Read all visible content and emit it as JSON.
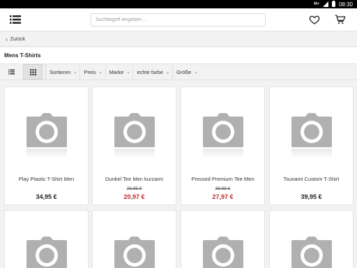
{
  "statusbar": {
    "network": "H+",
    "time": "08:30"
  },
  "header": {
    "search_placeholder": "Suchbegriff eingeben ...",
    "icons": {
      "menu": "hamburger-menu-icon",
      "wishlist": "heart-icon",
      "cart": "cart-icon"
    }
  },
  "backbar": {
    "label": "Zurück"
  },
  "page": {
    "title": "Mens T-Shirts"
  },
  "filters": [
    {
      "label": "Sortieren"
    },
    {
      "label": "Preis"
    },
    {
      "label": "Marke"
    },
    {
      "label": "echte farbe"
    },
    {
      "label": "Größe"
    }
  ],
  "colors": {
    "sale_price": "#c1272d",
    "placeholder_image": "#b0b0b0"
  },
  "products": [
    {
      "name": "Play Plastic T-Shirt Men",
      "old_price": "",
      "price": "34,95 €",
      "sale": false
    },
    {
      "name": "Dunkel Tee Men kurzarm",
      "old_price": "29,95 €",
      "price": "20,97 €",
      "sale": true
    },
    {
      "name": "Pressed Premium Tee Men",
      "old_price": "39,95 €",
      "price": "27,97 €",
      "sale": true
    },
    {
      "name": "Tsunami Custom T-Shirt",
      "old_price": "",
      "price": "39,95 €",
      "sale": false
    },
    {
      "name": "",
      "old_price": "",
      "price": "",
      "sale": false
    },
    {
      "name": "",
      "old_price": "",
      "price": "",
      "sale": false
    },
    {
      "name": "",
      "old_price": "",
      "price": "",
      "sale": false
    },
    {
      "name": "",
      "old_price": "",
      "price": "",
      "sale": false
    }
  ]
}
